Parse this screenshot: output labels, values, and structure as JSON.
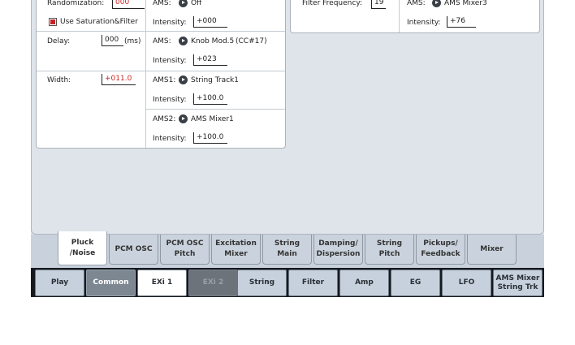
{
  "left_panel": {
    "randomization": {
      "label": "Randomization:",
      "value": "000"
    },
    "use_saturation": {
      "label": "Use Saturation&Filter",
      "checked": true
    },
    "rand_ams": {
      "label": "AMS:",
      "source": "Off",
      "intensity_label": "Intensity:",
      "intensity": "+000"
    },
    "delay": {
      "label": "Delay:",
      "value": "000",
      "unit": "(ms)"
    },
    "delay_ams": {
      "label": "AMS:",
      "source": "Knob Mod.5",
      "cc": "(CC#17)",
      "intensity_label": "Intensity:",
      "intensity": "+023"
    },
    "width": {
      "label": "Width:",
      "value": "+011.0"
    },
    "width_ams1": {
      "label": "AMS1:",
      "source": "String Track1",
      "intensity_label": "Intensity:",
      "intensity": "+100.0"
    },
    "width_ams2": {
      "label": "AMS2:",
      "source": "AMS Mixer1",
      "intensity_label": "Intensity:",
      "intensity": "+100.0"
    }
  },
  "right_panel": {
    "filter_frequency": {
      "label": "Filter Frequency:",
      "value": "19"
    },
    "ams": {
      "label": "AMS:",
      "source": "AMS Mixer3",
      "intensity_label": "Intensity:",
      "intensity": "+76"
    }
  },
  "tabs": [
    {
      "label": "Pluck\n/Noise",
      "active": true
    },
    {
      "label": "PCM OSC"
    },
    {
      "label": "PCM OSC\nPitch"
    },
    {
      "label": "Excitation\nMixer"
    },
    {
      "label": "String\nMain"
    },
    {
      "label": "Damping/\nDispersion"
    },
    {
      "label": "String\nPitch"
    },
    {
      "label": "Pickups/\nFeedback"
    },
    {
      "label": "Mixer"
    }
  ],
  "pages": [
    {
      "label": "Play"
    },
    {
      "label": "Common"
    },
    {
      "label": "EXi 1"
    },
    {
      "label": "EXi 2"
    },
    {
      "label": "String"
    },
    {
      "label": "Filter"
    },
    {
      "label": "Amp"
    },
    {
      "label": "EG"
    },
    {
      "label": "LFO"
    },
    {
      "label": "AMS Mixer\nString Trk"
    }
  ]
}
